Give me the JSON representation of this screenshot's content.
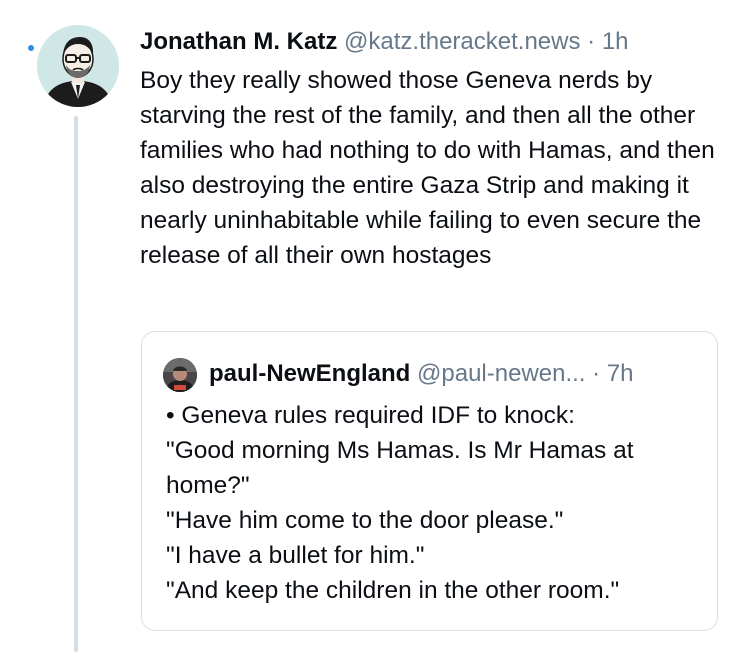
{
  "post": {
    "author": {
      "display_name": "Jonathan M. Katz",
      "handle": "@katz.theracket.news",
      "avatar_icon": "illustrated-portrait-avatar"
    },
    "separator": "·",
    "time": "1h",
    "text": "Boy they really showed those Geneva nerds by starving the rest of the family, and then all the other families who had nothing to do with Hamas, and then also destroying the entire Gaza Strip and making it nearly uninhabitable while failing to even secure the release of all their own hostages"
  },
  "quote": {
    "author": {
      "display_name": "paul-NewEngland",
      "handle": "@paul-newen...",
      "avatar_icon": "photo-avatar"
    },
    "separator": "·",
    "time": "7h",
    "lines": [
      "• Geneva rules required IDF to knock:",
      "\"Good morning Ms Hamas. Is Mr Hamas at home?\"",
      "\"Have him come to the door please.\"",
      "\"I have a bullet for him.\"",
      "\"And keep the children in the other room.\""
    ]
  },
  "colors": {
    "text": "#0b0f14",
    "muted": "#66788a",
    "thread_line": "#d5dde6",
    "card_border": "#d9e1e8",
    "unread_dot": "#2f8ee6"
  }
}
